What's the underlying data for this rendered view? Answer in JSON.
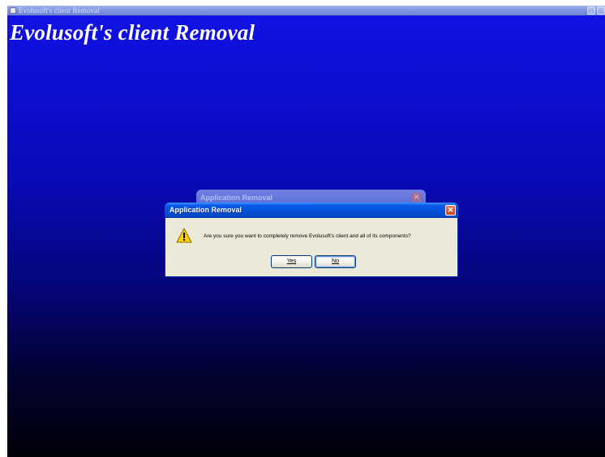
{
  "installer": {
    "title": "Evolusoft's client Removal",
    "heading": "Evolusoft's client Removal"
  },
  "dialog_back": {
    "title": "Application Removal"
  },
  "dialog": {
    "title": "Application Removal",
    "message": "Are you sure you want to completely remove Evolusoft's client and all of its components?",
    "yes_label": "Yes",
    "no_label": "No",
    "icon": "warning-icon"
  },
  "colors": {
    "desktop_top": "#1212e6",
    "desktop_bottom": "#000008",
    "dialog_face": "#ece9d8",
    "dialog_titlebar": "#0450d8"
  }
}
